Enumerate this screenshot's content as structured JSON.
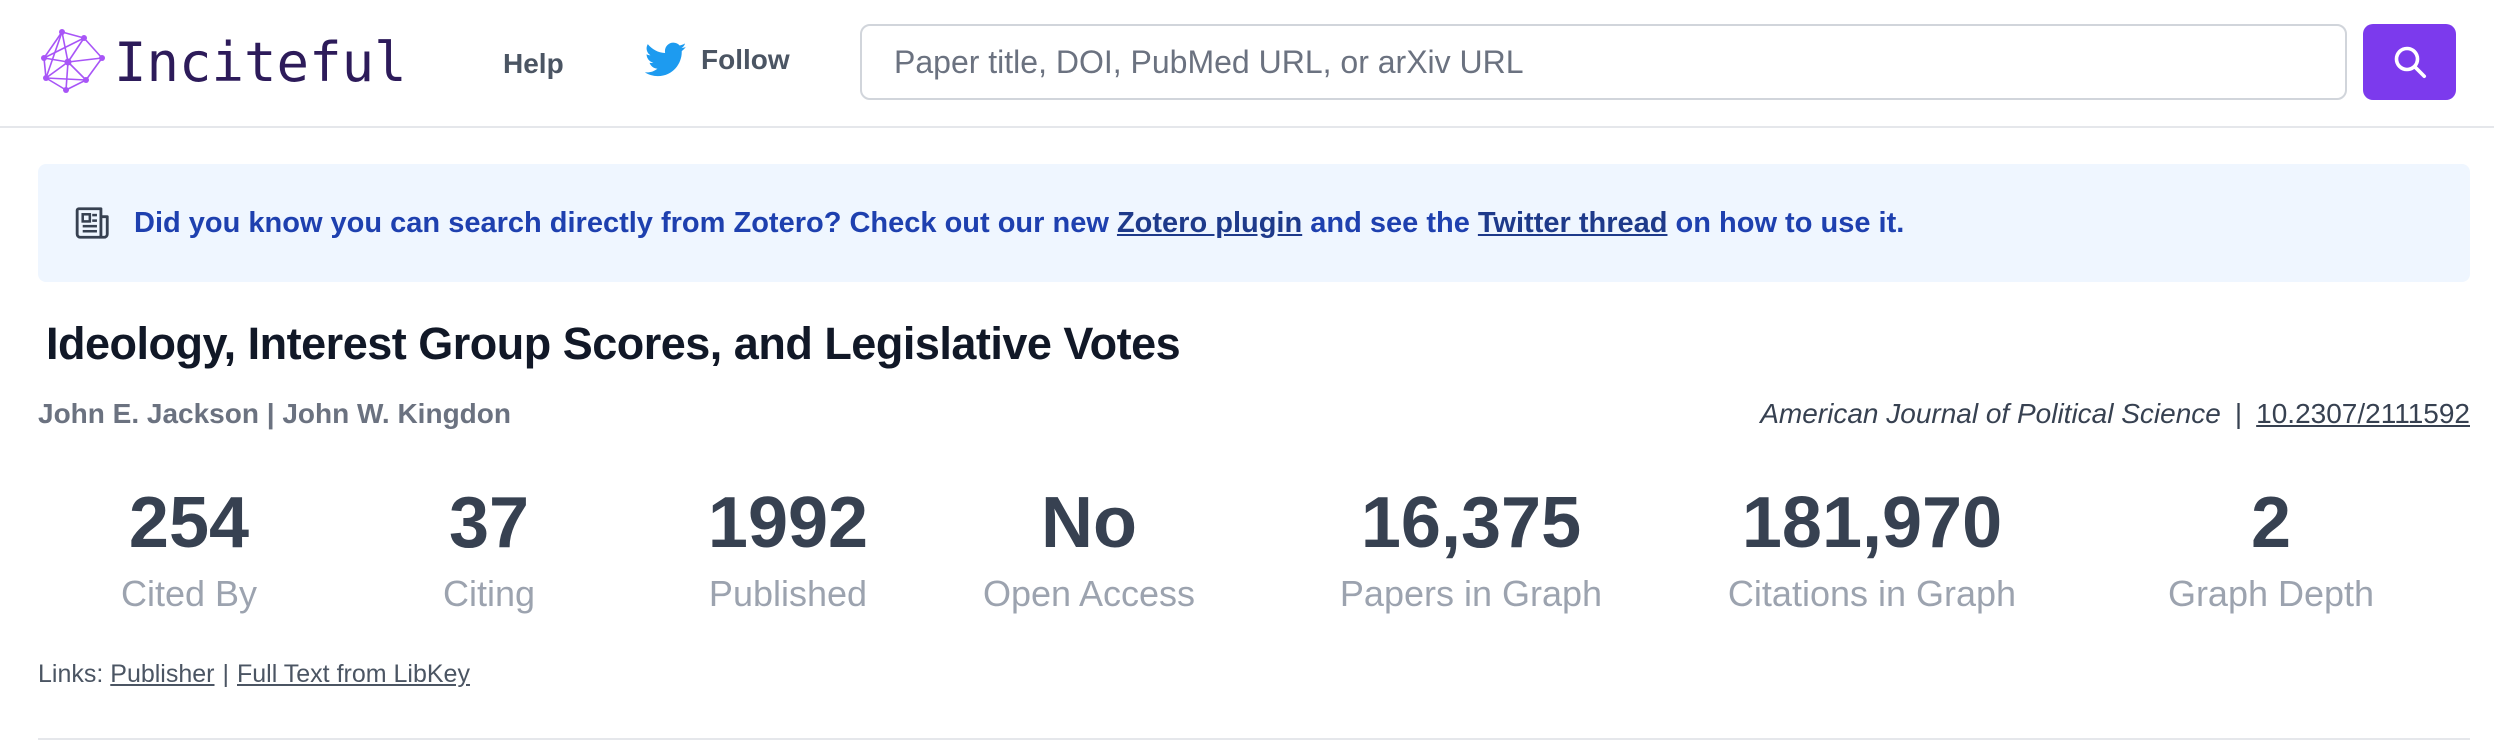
{
  "header": {
    "logo_text": "Inciteful",
    "help_label": "Help",
    "follow_label": "Follow",
    "search_placeholder": "Paper title, DOI, PubMed URL, or arXiv URL",
    "search_value": "",
    "accent_color": "#7c3aed",
    "icons": [
      "logo-network-icon",
      "twitter-icon",
      "search-icon"
    ]
  },
  "banner": {
    "icon": "newspaper-icon",
    "text_before": "Did you know you can search directly from Zotero? Check out our new ",
    "link1": "Zotero plugin",
    "text_middle": " and see the ",
    "link2": "Twitter thread",
    "text_after": " on how to use it.",
    "background_color": "#eff6ff",
    "text_color": "#1e40af"
  },
  "paper": {
    "title": "Ideology, Interest Group Scores, and Legislative Votes",
    "authors": "John E. Jackson | John W. Kingdon",
    "journal": "American Journal of Political Science",
    "separator": "|",
    "doi": "10.2307/2111592"
  },
  "stats": [
    {
      "value": "254",
      "label": "Cited By"
    },
    {
      "value": "37",
      "label": "Citing"
    },
    {
      "value": "1992",
      "label": "Published"
    },
    {
      "value": "No",
      "label": "Open Access"
    },
    {
      "value": "16,375",
      "label": "Papers in Graph"
    },
    {
      "value": "181,970",
      "label": "Citations in Graph"
    },
    {
      "value": "2",
      "label": "Graph Depth"
    }
  ],
  "links": {
    "prefix": "Links:",
    "items": [
      "Publisher",
      "Full Text from LibKey"
    ],
    "separator": "|"
  }
}
